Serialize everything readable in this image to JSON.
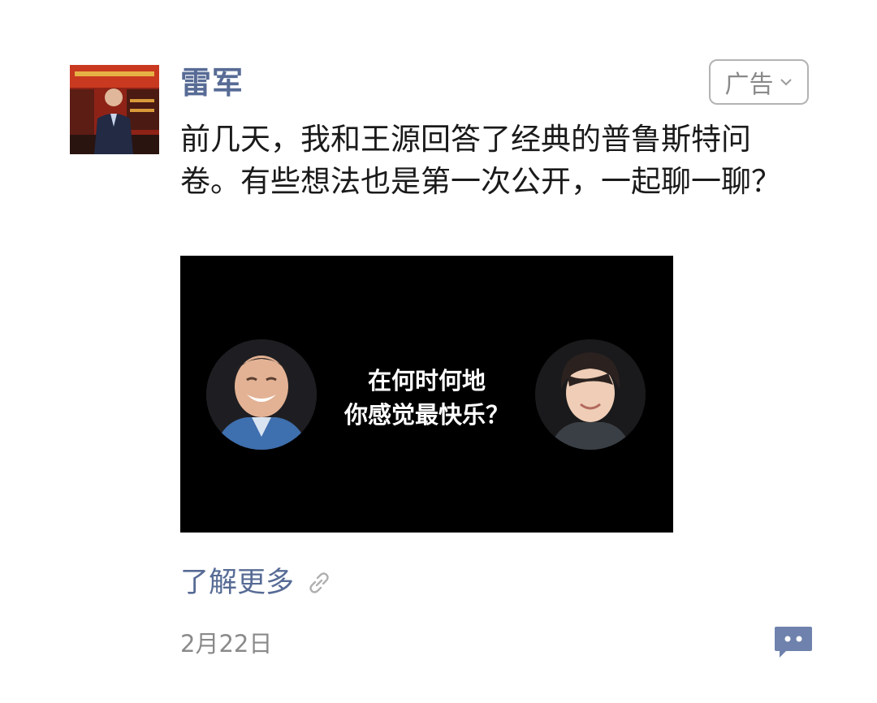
{
  "post": {
    "author_name": "雷军",
    "ad_label": "广告",
    "text": "前几天，我和王源回答了经典的普鲁斯特问卷。有些想法也是第一次公开，一起聊一聊？",
    "media": {
      "caption_line1": "在何时何地",
      "caption_line2": "你感觉最快乐？"
    },
    "learn_more_label": "了解更多",
    "date": "2月22日"
  },
  "icons": {
    "ad_dropdown": "chevron-down-icon",
    "learn_more": "link-icon",
    "comment": "comment-bubble-icon"
  },
  "colors": {
    "link_blue": "#576b95",
    "text": "#1a1a1a",
    "muted": "#8a8a8a",
    "media_bg": "#000000"
  }
}
